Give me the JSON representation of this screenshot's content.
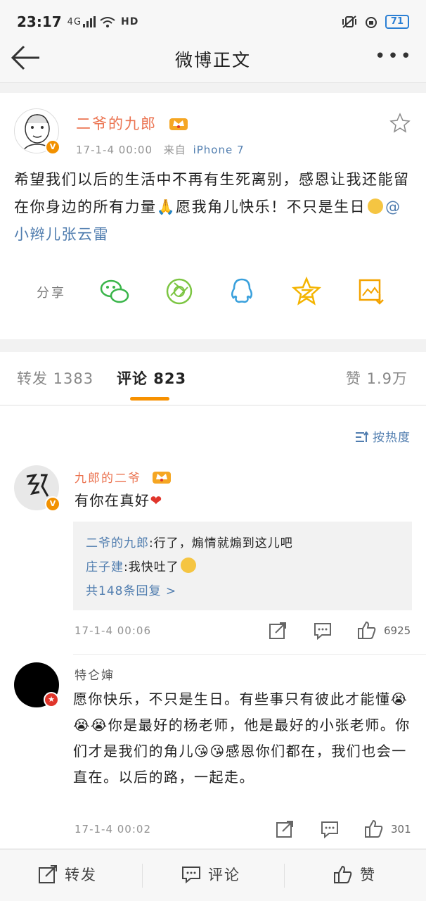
{
  "status_bar": {
    "time": "23:17",
    "network": "4G",
    "hd": "HD",
    "battery": "71"
  },
  "navbar": {
    "title": "微博正文",
    "more": "•••"
  },
  "post": {
    "author": "二爷的九郎",
    "verified": "V",
    "time": "17-1-4 00:00",
    "source_prefix": "来自",
    "source": "iPhone 7",
    "text_part1": "希望我们以后的生活中不再有生死离别，感恩让我还能留在你身边的所有力量",
    "text_part2": "愿我角儿快乐！不只是生日",
    "mention": "@小辫儿张云雷",
    "share_label": "分享"
  },
  "tabs": {
    "repost": "转发 1383",
    "comment": "评论 823",
    "like": "赞 1.9万"
  },
  "comments": {
    "sort_label": "按热度",
    "items": [
      {
        "name": "九郎的二爷",
        "text": "有你在真好",
        "replies": [
          {
            "name": "二爷的九郎",
            "text": ":行了，煽情就煽到这儿吧"
          },
          {
            "name": "庄子建",
            "text": ":我快吐了"
          }
        ],
        "reply_total": "共148条回复 >",
        "time": "17-1-4 00:06",
        "likes": "6925"
      },
      {
        "name": "特仑婶",
        "text_a": "愿你快乐，不只是生日。有些事只有彼此才能懂",
        "text_b": "你是最好的杨老师，他是最好的小张老师。你们才是我们的角儿",
        "text_c": "感恩你们都在，我们也会一直在。以后的路，一起走。",
        "time": "17-1-4 00:02",
        "likes": "301"
      }
    ]
  },
  "bottom_bar": {
    "repost": "转发",
    "comment": "评论",
    "like": "赞"
  },
  "colors": {
    "accent_orange": "#f79100",
    "name_orange": "#eb7350",
    "link_blue": "#507daf"
  }
}
